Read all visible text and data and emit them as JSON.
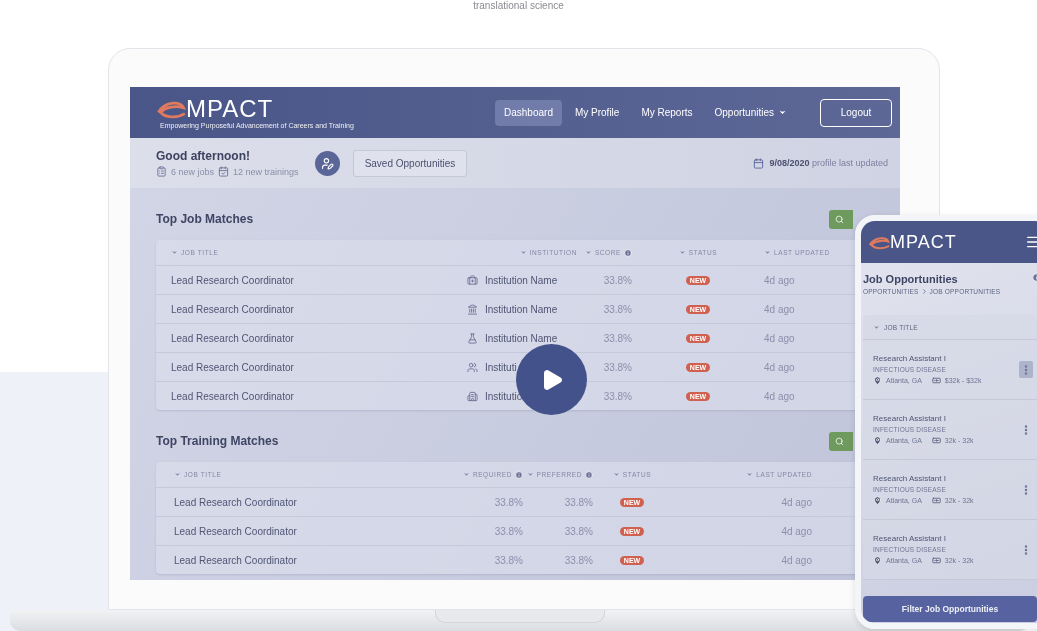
{
  "page": {
    "heading_fragment": "translational science"
  },
  "laptop": {
    "header": {
      "logo": "MPACT",
      "tagline": "Empowering Purposeful Advancement of Careers and Training",
      "nav": [
        {
          "label": "Dashboard",
          "selected": true,
          "caret": false
        },
        {
          "label": "My Profile",
          "selected": false,
          "caret": false
        },
        {
          "label": "My Reports",
          "selected": false,
          "caret": false
        },
        {
          "label": "Opportunities",
          "selected": false,
          "caret": true
        }
      ],
      "logout": "Logout"
    },
    "greeting": {
      "title": "Good afternoon!",
      "jobs_count": "6",
      "jobs_label": "new jobs",
      "trainings_count": "12",
      "trainings_label": "new trainings",
      "saved_button": "Saved Opportunities",
      "date": "9/08/2020",
      "date_label": "profile last updated"
    },
    "job_matches": {
      "title": "Top Job Matches",
      "columns": [
        {
          "label": "JOB TITLE",
          "info": false
        },
        {
          "label": "INSTITUTION",
          "info": false
        },
        {
          "label": "SCORE",
          "info": true
        },
        {
          "label": "STATUS",
          "info": false
        },
        {
          "label": "LAST UPDATED",
          "info": false
        }
      ],
      "rows": [
        {
          "title": "Lead Research Coordinator",
          "kind": "medical",
          "institution": "Institution Name",
          "score": "33.8%",
          "status": "NEW",
          "updated": "4d ago"
        },
        {
          "title": "Lead Research Coordinator",
          "kind": "bank",
          "institution": "Institution Name",
          "score": "33.8%",
          "status": "NEW",
          "updated": "4d ago"
        },
        {
          "title": "Lead Research Coordinator",
          "kind": "flask",
          "institution": "Institution Name",
          "score": "33.8%",
          "status": "NEW",
          "updated": "4d ago"
        },
        {
          "title": "Lead Research Coordinator",
          "kind": "people",
          "institution": "Instituti",
          "score": "33.8%",
          "status": "NEW",
          "updated": "4d ago"
        },
        {
          "title": "Lead Research Coordinator",
          "kind": "building",
          "institution": "Institutio",
          "score": "33.8%",
          "status": "NEW",
          "updated": "4d ago"
        }
      ]
    },
    "training_matches": {
      "title": "Top Training Matches",
      "columns": [
        {
          "label": "JOB TITLE",
          "info": false
        },
        {
          "label": "REQUIRED",
          "info": true
        },
        {
          "label": "PREFERRED",
          "info": true
        },
        {
          "label": "STATUS",
          "info": false
        },
        {
          "label": "LAST UPDATED",
          "info": false
        }
      ],
      "rows": [
        {
          "title": "Lead Research Coordinator",
          "required": "33.8%",
          "preferred": "33.8%",
          "status": "NEW",
          "updated": "4d ago"
        },
        {
          "title": "Lead Research Coordinator",
          "required": "33.8%",
          "preferred": "33.8%",
          "status": "NEW",
          "updated": "4d ago"
        },
        {
          "title": "Lead Research Coordinator",
          "required": "33.8%",
          "preferred": "33.8%",
          "status": "NEW",
          "updated": "4d ago"
        }
      ]
    }
  },
  "phone": {
    "logo": "MPACT",
    "title": "Job Opportunities",
    "breadcrumb": [
      "OPPORTUNITIES",
      "JOB OPPORTUNITIES"
    ],
    "column": "JOB TITLE",
    "items": [
      {
        "title": "Research Assistant I",
        "category": "INFECTIOUS DISEASE",
        "location": "Atlanta, GA",
        "salary": "$32k - $32k",
        "selected": true
      },
      {
        "title": "Research Assistant I",
        "category": "INFECTIOUS DISEASE",
        "location": "Atlanta, GA",
        "salary": "32k - 32k",
        "selected": false
      },
      {
        "title": "Research Assistant I",
        "category": "INFECTIOUS DISEASE",
        "location": "Atlanta, GA",
        "salary": "32k - 32k",
        "selected": false
      },
      {
        "title": "Research Assistant I",
        "category": "INFECTIOUS DISEASE",
        "location": "Atlanta, GA",
        "salary": "32k - 32k",
        "selected": false
      }
    ],
    "filter_button": "Filter Job Opportunities"
  }
}
